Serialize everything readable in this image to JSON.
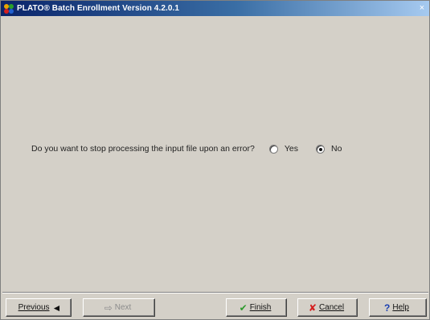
{
  "window": {
    "title": "PLATO® Batch Enrollment Version 4.2.0.1",
    "close_glyph": "×"
  },
  "question": {
    "text": "Do you want to stop processing the input file upon an error?",
    "options": [
      {
        "label": "Yes",
        "selected": false
      },
      {
        "label": "No",
        "selected": true
      }
    ]
  },
  "buttons": {
    "previous": {
      "label": "Previous",
      "icon": "arrow-left-icon",
      "glyph": "◄"
    },
    "next": {
      "label": "Next",
      "icon": "arrow-right-icon",
      "glyph": "⇨",
      "enabled": false
    },
    "finish": {
      "label": "Finish",
      "icon": "check-icon",
      "glyph": "✔",
      "color": "#2e9a2e"
    },
    "cancel": {
      "label": "Cancel",
      "icon": "x-icon",
      "glyph": "✘",
      "color": "#d42020"
    },
    "help": {
      "label": "Help",
      "icon": "question-icon",
      "glyph": "?",
      "color": "#1a3fb0"
    }
  }
}
